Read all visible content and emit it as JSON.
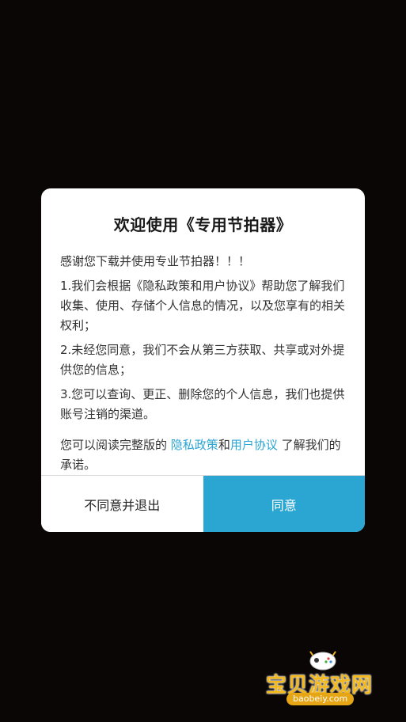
{
  "dialog": {
    "title": "欢迎使用《专用节拍器》",
    "intro": "感谢您下载并使用专业节拍器！！！",
    "items": [
      "1.我们会根据《隐私政策和用户协议》帮助您了解我们收集、使用、存储个人信息的情况，以及您享有的相关权利；",
      "2.未经您同意，我们不会从第三方获取、共享或对外提供您的信息；",
      "3.您可以查询、更正、删除您的个人信息，我们也提供账号注销的渠道。"
    ],
    "footer_prefix": "您可以阅读完整版的",
    "privacy_link": "隐私政策",
    "footer_and": "和",
    "user_link": "用户协议",
    "footer_suffix": "了解我们的承诺。"
  },
  "buttons": {
    "decline_label": "不同意并退出",
    "agree_label": "同意"
  },
  "watermark": {
    "brand": "宝贝游戏网",
    "url": "baobeiy.com"
  },
  "colors": {
    "accent": "#2ba6d3",
    "background": "#0b0606",
    "watermark": "#f2b81c"
  }
}
